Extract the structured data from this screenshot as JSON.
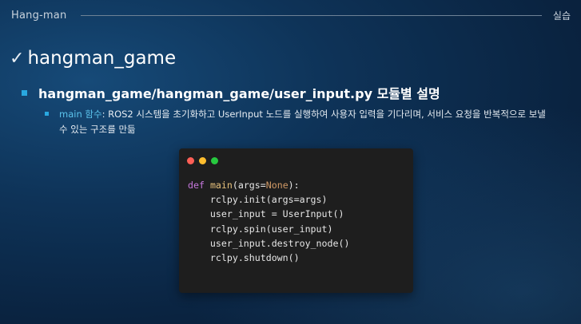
{
  "header": {
    "title": "Hang-man",
    "right_label": "실습"
  },
  "heading1": {
    "check": "✓",
    "text": "hangman_game"
  },
  "heading2": {
    "text": "hangman_game/hangman_game/user_input.py 모듈별 설명"
  },
  "bullet": {
    "key": "main 함수",
    "text": ": ROS2 시스템을 초기화하고 UserInput 노드를 실행하여 사용자 입력을 기다리며, 서비스 요청을 반복적으로 보낼 수 있는 구조를 만듦"
  },
  "code": {
    "line1": {
      "kw": "def",
      "fn": "main",
      "open": "(args=",
      "none": "None",
      "close": "):"
    },
    "line2": "rclpy.init(args=args)",
    "line3": "user_input = UserInput()",
    "line4": "rclpy.spin(user_input)",
    "line5": "user_input.destroy_node()",
    "line6": "rclpy.shutdown()"
  },
  "colors": {
    "accent": "#29a8e0",
    "bullet_key": "#5cc4ee",
    "code_bg": "#1e1e1e",
    "keyword": "#c678dd",
    "function": "#e6c07b",
    "constant": "#d19a66"
  }
}
